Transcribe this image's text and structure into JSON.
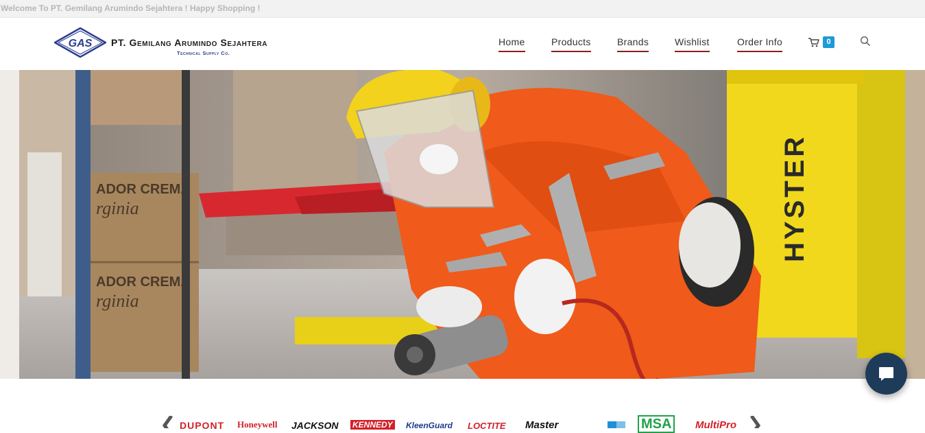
{
  "topbar": {
    "welcome": "Welcome To PT. Gemilang Arumindo Sejahtera ! Happy Shopping !"
  },
  "logo": {
    "emblem_text": "GAS",
    "company": "PT. Gemilang Arumindo Sejahtera",
    "tagline": "Technical Supply Co."
  },
  "nav": {
    "home": "Home",
    "products": "Products",
    "brands": "Brands",
    "wishlist": "Wishlist",
    "order_info": "Order Info"
  },
  "cart": {
    "count": "0",
    "icon": "cart-icon"
  },
  "search": {
    "icon": "search-icon"
  },
  "hero": {
    "forklift_text": "HYSTER",
    "box_label_1": "ADOR CREMA",
    "box_label_2": "rginia",
    "box_label_3": "ADOR CREMA",
    "box_label_4": "rginia"
  },
  "brands": {
    "items": [
      "DUPONT",
      "Honeywell",
      "JACKSON",
      "KENNEDY",
      "KleenGuard",
      "LOCTITE",
      "Master",
      "MSA",
      "MultiPro"
    ]
  },
  "colors": {
    "accent": "#8a1c1c",
    "badge": "#1e9ad6",
    "chat": "#1f3b5a",
    "logo_blue": "#2a3d8f"
  }
}
